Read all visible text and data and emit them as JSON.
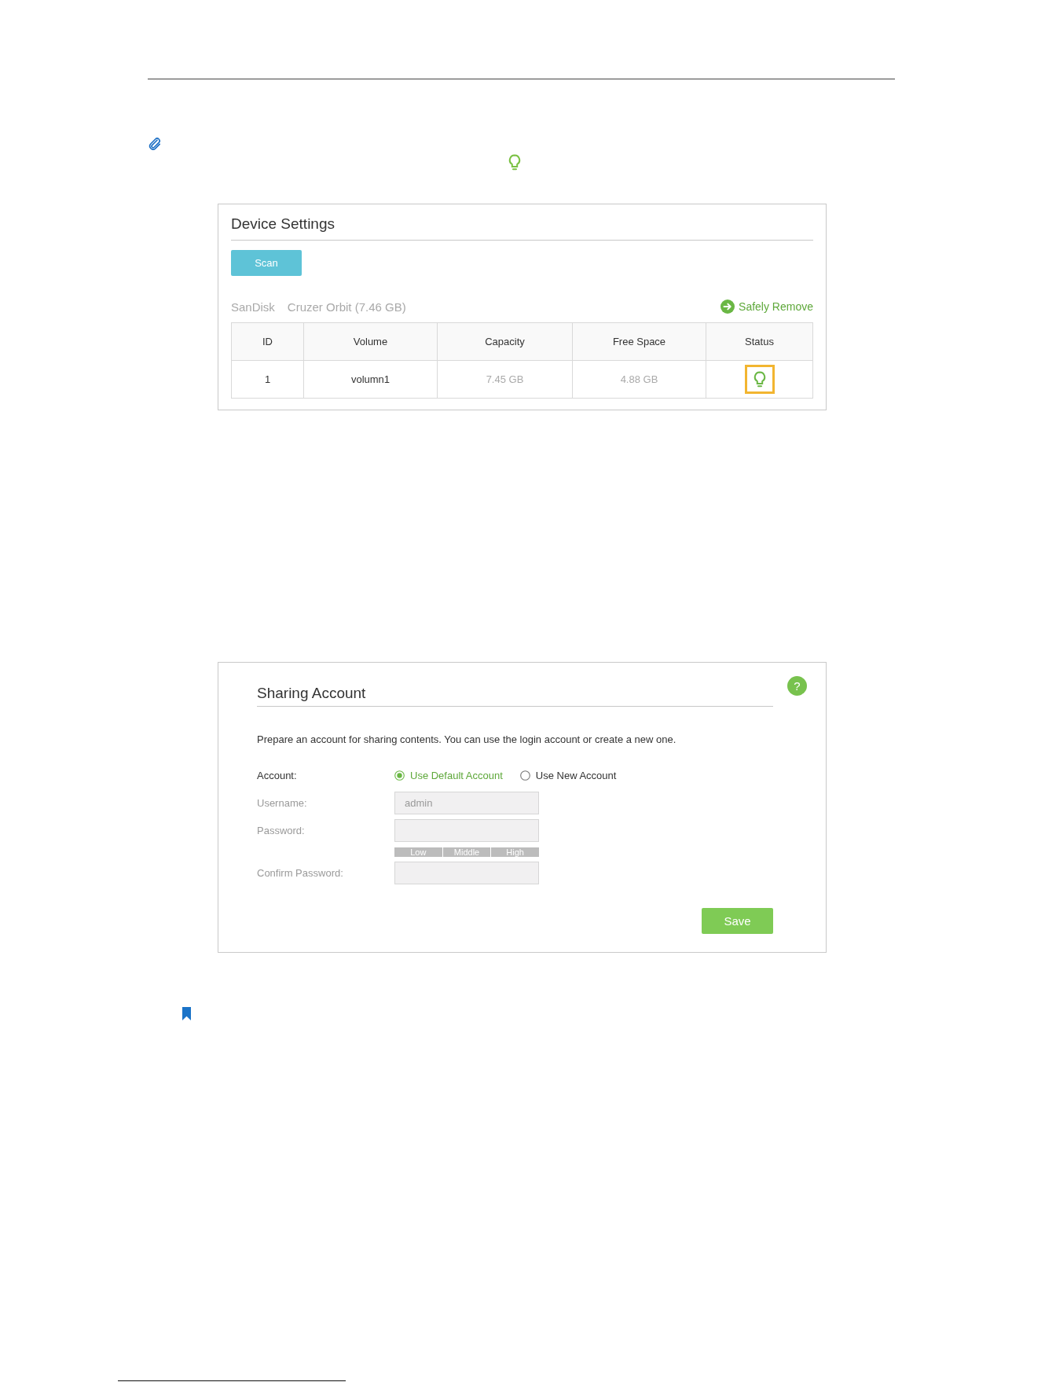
{
  "device_settings": {
    "title": "Device Settings",
    "scan_button": "Scan",
    "device_brand": "SanDisk",
    "device_model": "Cruzer Orbit (7.46 GB)",
    "safely_remove_link": "Safely Remove",
    "table": {
      "columns": [
        "ID",
        "Volume",
        "Capacity",
        "Free Space",
        "Status"
      ],
      "rows": [
        {
          "id": "1",
          "volume": "volumn1",
          "capacity": "7.45 GB",
          "free_space": "4.88 GB",
          "status_on": true,
          "highlighted": true
        }
      ]
    }
  },
  "sharing_account": {
    "help_button": "?",
    "title": "Sharing Account",
    "description": "Prepare an account for sharing contents. You can use the login account or create a new one.",
    "account": {
      "label": "Account:",
      "options": [
        {
          "label": "Use Default Account",
          "selected": true
        },
        {
          "label": "Use New Account",
          "selected": false
        }
      ]
    },
    "fields": [
      {
        "kind": "text",
        "label": "Username:",
        "value": "admin",
        "disabled": true
      },
      {
        "kind": "password",
        "label": "Password:",
        "disabled": true,
        "strength_meter": [
          "Low",
          "Middle",
          "High"
        ]
      },
      {
        "kind": "password",
        "label": "Confirm Password:",
        "disabled": true
      }
    ],
    "save_button": "Save"
  }
}
